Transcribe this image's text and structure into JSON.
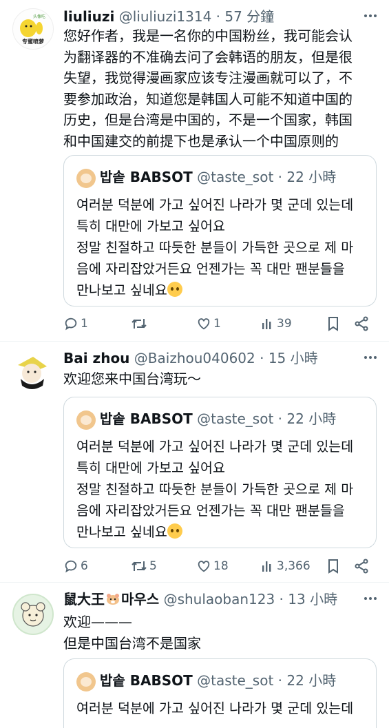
{
  "quote": {
    "name": "밥솥 BABSOT",
    "handle": "@taste_sot",
    "time": "22 小時",
    "lines": [
      "여러분 덕분에 가고 싶어진 나라가 몇 군데 있는데",
      "특히 대만에 가보고 싶어요",
      "정말 친절하고 따듯한 분들이 가득한 곳으로 제 마",
      "음에 자리잡았거든요 언젠가는 꼭 대만 팬분들을",
      "만나보고 싶네요"
    ],
    "emoji": "pleading-face"
  },
  "tweets": [
    {
      "name": "liuliuzi",
      "handle": "@liuliuzi1314",
      "time": "57 分鐘",
      "lines": [
        "您好作者，我是一名你的中国粉丝，我可能会认",
        "为翻译器的不准确去问了会韩语的朋友，但是很",
        "失望，我觉得漫画家应该专注漫画就可以了，不",
        "要参加政治，知道您是韩国人可能不知道中国的",
        "历史，但是台湾是中国的，不是一个国家，韩国",
        "和中国建交的前提下也是承认一个中国原则的"
      ],
      "stats": {
        "replies": "1",
        "retweets": "",
        "likes": "1",
        "views": "39"
      }
    },
    {
      "name": "Bai zhou",
      "handle": "@Baizhou040602",
      "time": "15 小時",
      "lines": [
        "欢迎您来中国台湾玩～"
      ],
      "stats": {
        "replies": "6",
        "retweets": "5",
        "likes": "18",
        "views": "3,366"
      }
    },
    {
      "name": "鼠大王",
      "name_suffix": "마우스",
      "handle": "@shulaoban123",
      "time": "13 小時",
      "lines": [
        "欢迎———",
        "但是中国台湾不是国家"
      ]
    }
  ],
  "avatar_texts": {
    "t1_top": "头像吃",
    "t1_bottom": "专蜜喷萝"
  },
  "icons": [
    "reply-icon",
    "retweet-icon",
    "like-icon",
    "views-icon",
    "bookmark-icon",
    "share-icon",
    "more-icon"
  ],
  "colors": {
    "text": "#0f1419",
    "secondary": "#536471",
    "border": "#cfd9de"
  }
}
